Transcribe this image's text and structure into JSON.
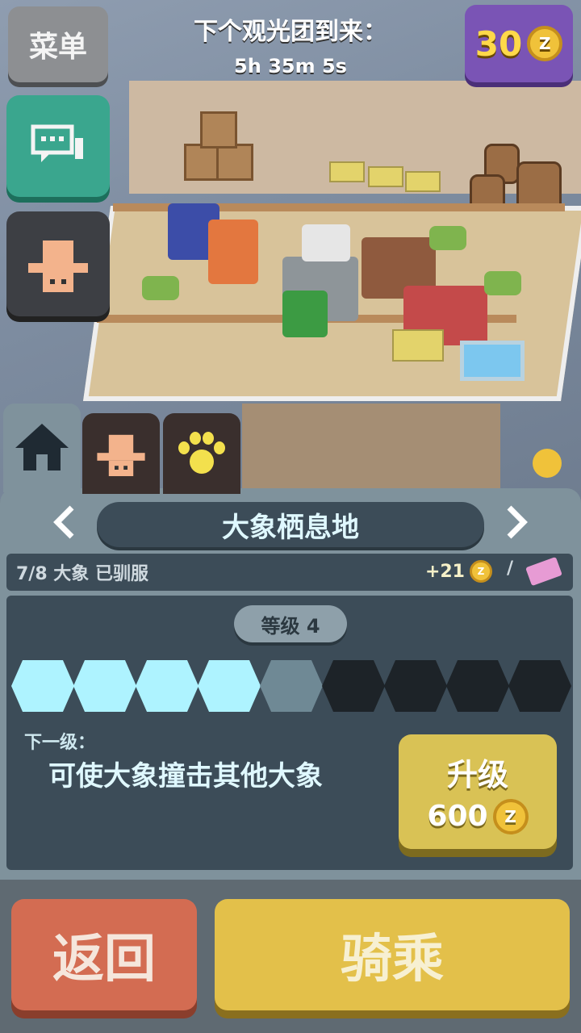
{
  "hud": {
    "menu_label": "菜单",
    "timer_title": "下个观光团到来：",
    "timer_value": "5h 35m 5s",
    "coin_count": "30",
    "coin_icon": "coin-icon",
    "coin_symbol": "Z"
  },
  "side_buttons": [
    {
      "name": "chat-button",
      "icon": "chat-bubbles-icon"
    },
    {
      "name": "zookeeper-button",
      "icon": "cowboy-hat-icon"
    }
  ],
  "tabs": [
    {
      "name": "tab-home",
      "icon": "house-icon",
      "active": true
    },
    {
      "name": "tab-zookeeper",
      "icon": "cowboy-hat-icon",
      "active": false
    },
    {
      "name": "tab-animals",
      "icon": "paw-icon",
      "active": false
    }
  ],
  "habitat": {
    "title": "大象栖息地",
    "tamed_status": "7/8 大象 已驯服",
    "reward": "+21",
    "reward_separator": "/",
    "level_label": "等级 4",
    "level_segments_total": 9,
    "level_segments_filled": 4,
    "next_label": "下一级：",
    "next_description": "可使大象撞击其他大象",
    "upgrade_label": "升级",
    "upgrade_cost": "600"
  },
  "actions": {
    "back_label": "返回",
    "ride_label": "骑乘"
  },
  "colors": {
    "accent_teal": "#3aa68e",
    "coin_purple": "#7a54b5",
    "progress_on": "#aef3ff",
    "upgrade_gold": "#d9c255",
    "back_red": "#d36c52",
    "ride_gold": "#e3c04a"
  }
}
